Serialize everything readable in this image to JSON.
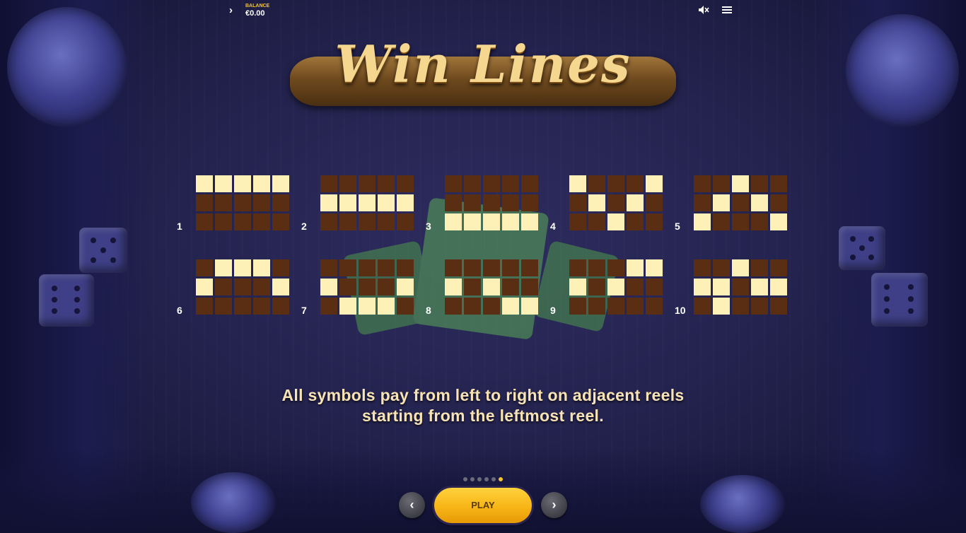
{
  "header": {
    "balance_label": "BALANCE",
    "balance_value": "€0.00"
  },
  "icons": {
    "expand": "chevron-right-icon",
    "sound": "speaker-muted-icon",
    "menu": "hamburger-menu-icon"
  },
  "title": "Win Lines",
  "win_lines": [
    {
      "number": "1",
      "rows": [
        "11111",
        "00000",
        "00000"
      ]
    },
    {
      "number": "2",
      "rows": [
        "00000",
        "11111",
        "00000"
      ]
    },
    {
      "number": "3",
      "rows": [
        "00000",
        "00000",
        "11111"
      ]
    },
    {
      "number": "4",
      "rows": [
        "10001",
        "01010",
        "00100"
      ]
    },
    {
      "number": "5",
      "rows": [
        "00100",
        "01010",
        "10001"
      ]
    },
    {
      "number": "6",
      "rows": [
        "01110",
        "10001",
        "00000"
      ]
    },
    {
      "number": "7",
      "rows": [
        "00000",
        "10001",
        "01110"
      ]
    },
    {
      "number": "8",
      "rows": [
        "00000",
        "10100",
        "00011"
      ]
    },
    {
      "number": "9",
      "rows": [
        "00011",
        "10100",
        "00000"
      ]
    },
    {
      "number": "10",
      "rows": [
        "00100",
        "11011",
        "01000"
      ]
    }
  ],
  "description_line1": "All symbols pay from left to right on adjacent reels",
  "description_line2": "starting from the leftmost reel.",
  "pagination": {
    "total": 6,
    "active_index": 5
  },
  "buttons": {
    "prev": "‹",
    "play": "PLAY",
    "next": "›"
  },
  "colors": {
    "line_on": "#fdf1b8",
    "line_off": "#5a2e12",
    "accent": "#f4c430"
  }
}
